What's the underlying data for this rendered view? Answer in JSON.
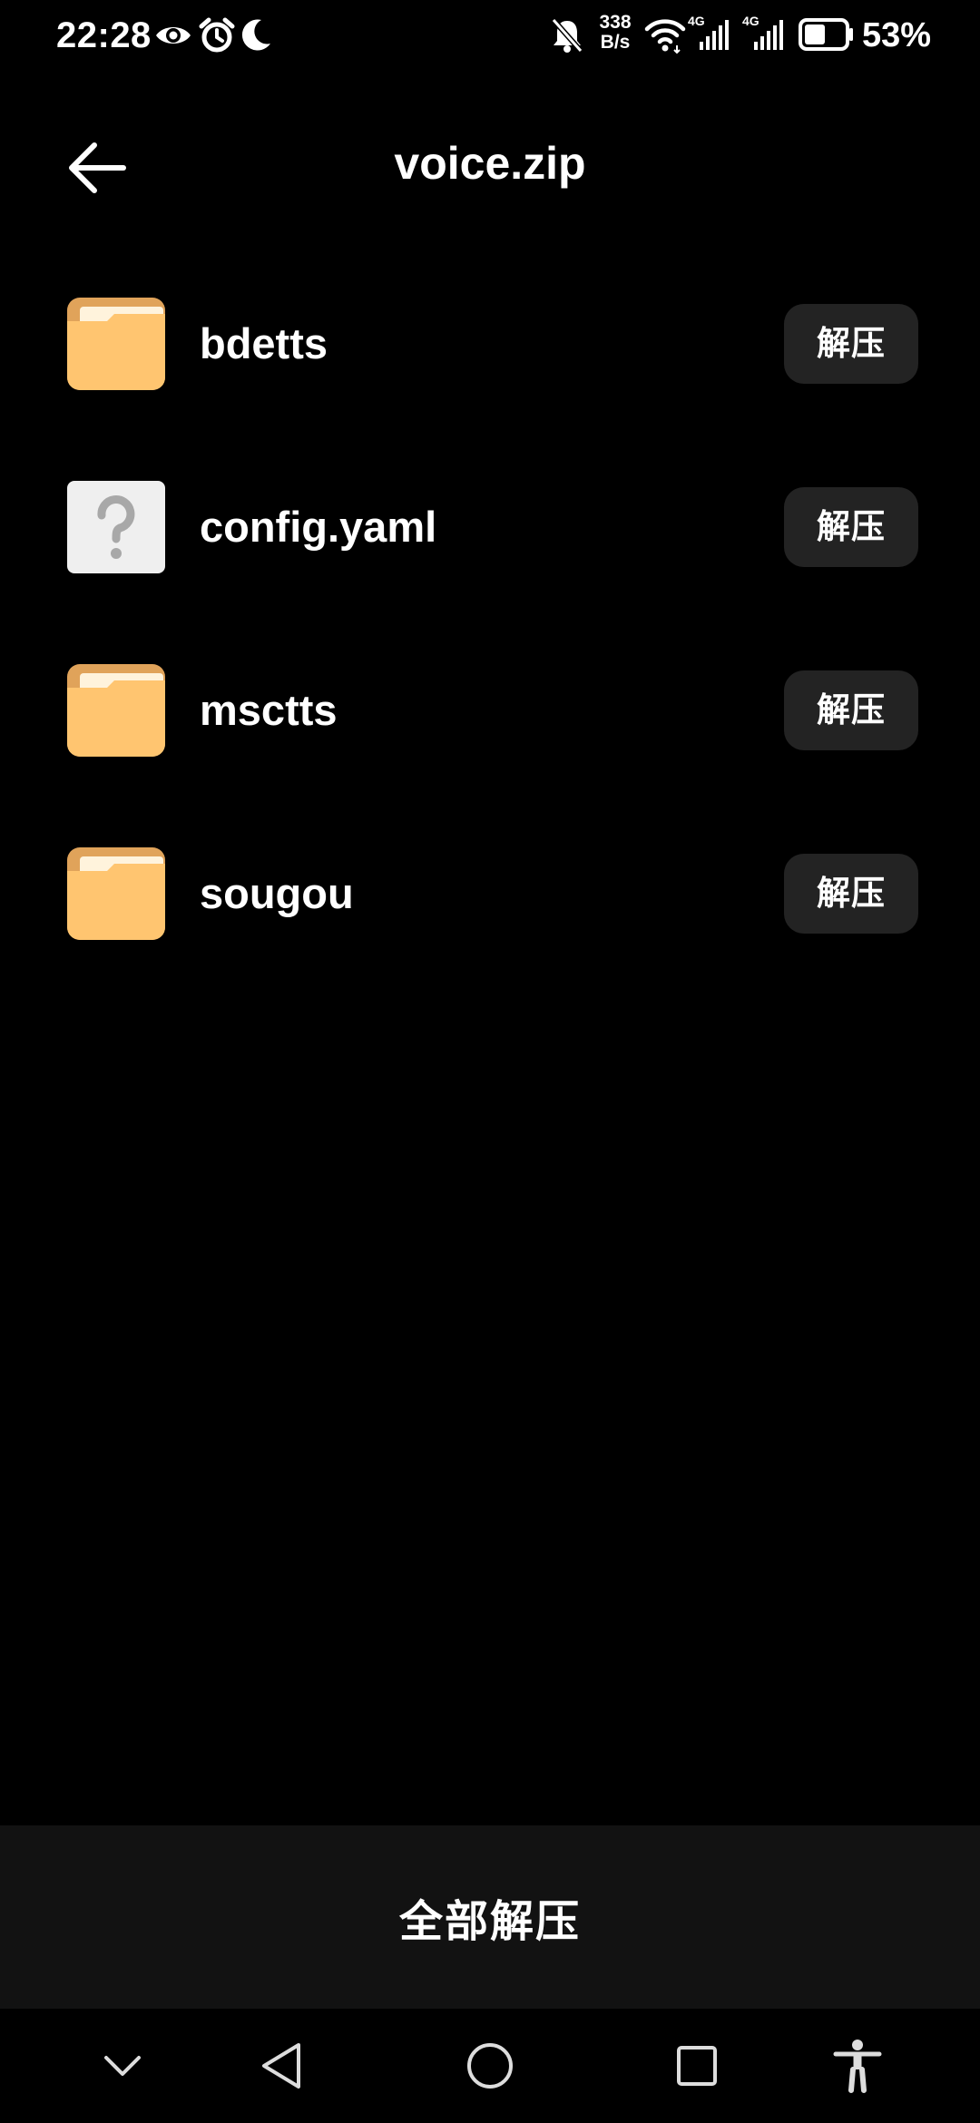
{
  "status_bar": {
    "time": "22:28",
    "net_speed_value": "338",
    "net_speed_unit": "B/s",
    "network_label_1": "4G",
    "network_label_2": "4G",
    "battery_percent": "53%",
    "battery_level": 0.53,
    "icons": [
      "eye-icon",
      "alarm-icon",
      "moon-icon",
      "bell-off-icon",
      "wifi-icon",
      "signal-icon",
      "battery-icon"
    ]
  },
  "header": {
    "title": "voice.zip",
    "back_icon": "arrow-left-icon"
  },
  "files": [
    {
      "name": "bdetts",
      "type": "folder",
      "action_label": "解压"
    },
    {
      "name": "config.yaml",
      "type": "unknown",
      "action_label": "解压"
    },
    {
      "name": "msctts",
      "type": "folder",
      "action_label": "解压"
    },
    {
      "name": "sougou",
      "type": "folder",
      "action_label": "解压"
    }
  ],
  "bottom_bar": {
    "extract_all_label": "全部解压"
  },
  "nav_bar": {
    "icons": [
      "chevron-down-icon",
      "back-triangle-icon",
      "home-circle-icon",
      "recents-square-icon",
      "accessibility-icon"
    ]
  },
  "colors": {
    "background": "#000000",
    "text": "#ffffff",
    "button_bg": "#232323",
    "bottom_bar_bg": "#121212",
    "folder_body": "#FFC570",
    "folder_tab": "#E0A35A",
    "unknown_file_bg": "#EFEFEF",
    "unknown_file_glyph": "#A8A8A8"
  }
}
